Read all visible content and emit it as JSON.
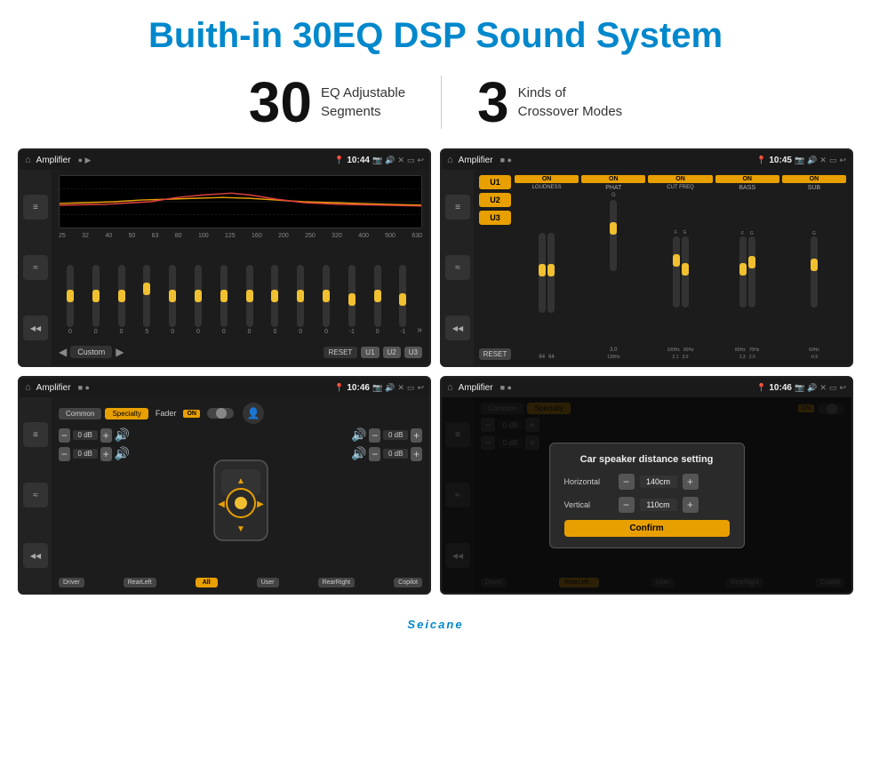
{
  "header": {
    "title": "Buith-in 30EQ DSP Sound System"
  },
  "stats": {
    "eq_number": "30",
    "eq_desc_line1": "EQ Adjustable",
    "eq_desc_line2": "Segments",
    "cx_number": "3",
    "cx_desc_line1": "Kinds of",
    "cx_desc_line2": "Crossover Modes"
  },
  "screen1": {
    "title": "Amplifier",
    "time": "10:44",
    "freq_labels": [
      "25",
      "32",
      "40",
      "50",
      "63",
      "80",
      "100",
      "125",
      "160",
      "200",
      "250",
      "320",
      "400",
      "500",
      "630"
    ],
    "slider_values": [
      "0",
      "0",
      "0",
      "5",
      "0",
      "0",
      "0",
      "0",
      "0",
      "0",
      "0",
      "-1",
      "0",
      "-1"
    ],
    "preset": "Custom",
    "buttons": [
      "RESET",
      "U1",
      "U2",
      "U3"
    ]
  },
  "screen2": {
    "title": "Amplifier",
    "time": "10:45",
    "presets": [
      "U1",
      "U2",
      "U3"
    ],
    "channels": [
      {
        "header": "ON",
        "name": "LOUDNESS"
      },
      {
        "header": "ON",
        "name": "PHAT"
      },
      {
        "header": "ON",
        "name": "CUT FREQ"
      },
      {
        "header": "ON",
        "name": "BASS"
      },
      {
        "header": "ON",
        "name": "SUB"
      }
    ],
    "reset_label": "RESET"
  },
  "screen3": {
    "title": "Amplifier",
    "time": "10:46",
    "tabs": [
      "Common",
      "Specialty"
    ],
    "fader_label": "Fader",
    "fader_on": "ON",
    "controls": [
      {
        "value": "0 dB"
      },
      {
        "value": "0 dB"
      },
      {
        "value": "0 dB"
      },
      {
        "value": "0 dB"
      }
    ],
    "buttons": [
      "Driver",
      "RearLeft",
      "All",
      "User",
      "RearRight",
      "Copilot"
    ]
  },
  "screen4": {
    "title": "Amplifier",
    "time": "10:46",
    "tabs": [
      "Common",
      "Specialty"
    ],
    "dialog": {
      "title": "Car speaker distance setting",
      "horizontal_label": "Horizontal",
      "horizontal_value": "140cm",
      "vertical_label": "Vertical",
      "vertical_value": "110cm",
      "confirm_label": "Confirm"
    },
    "buttons": [
      "Driver",
      "RearLeft",
      "User",
      "RearRight",
      "Copilot"
    ],
    "db_values": [
      "0 dB",
      "0 dB"
    ]
  },
  "watermark": "Seicane",
  "sidebar_icons": [
    "≡",
    "≈",
    "~",
    "◂◂"
  ]
}
